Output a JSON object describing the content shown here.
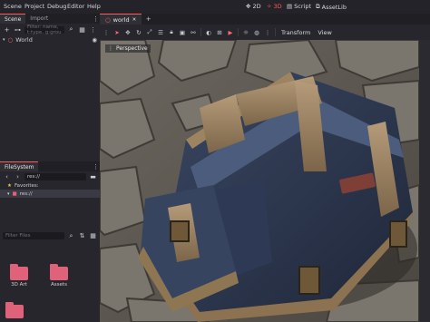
{
  "menubar": {
    "items": [
      "Scene",
      "Project",
      "Debug",
      "Editor",
      "Help"
    ],
    "workspaces": [
      {
        "icon": "2d-icon",
        "label": "2D",
        "active": false
      },
      {
        "icon": "3d-icon",
        "label": "3D",
        "active": true
      },
      {
        "icon": "script-icon",
        "label": "Script",
        "active": false
      },
      {
        "icon": "assetlib-icon",
        "label": "AssetLib",
        "active": false
      }
    ]
  },
  "scene_dock": {
    "tabs": [
      "Scene",
      "Import"
    ],
    "filter_placeholder": "Filter: name, t:type, g:grou",
    "root_node": "World"
  },
  "filesystem_dock": {
    "tab": "FileSystem",
    "path": "res://",
    "favorites_label": "Favorites:",
    "res_label": "res://",
    "filter_placeholder": "Filter Files",
    "folders": [
      "3D Art",
      "Assets",
      ""
    ]
  },
  "main": {
    "tab_label": "world",
    "viewport_menu": [
      "Transform",
      "View"
    ],
    "perspective_label": "Perspective"
  },
  "colors": {
    "accent": "#ff5a5a",
    "folder": "#e0627a",
    "background": "#1d1d22"
  }
}
